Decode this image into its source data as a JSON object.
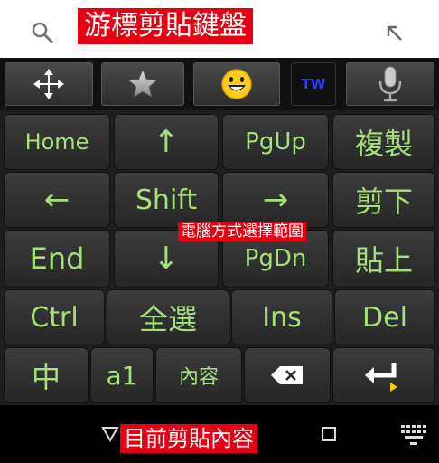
{
  "header": {
    "title_label": "游標剪貼鍵盤",
    "search_icon": "search-icon",
    "back_icon": "arrow-up-left-icon"
  },
  "toolbar": {
    "buttons": [
      {
        "name": "move-cursor",
        "icon": "move-arrows-icon"
      },
      {
        "name": "favorite",
        "icon": "star-icon"
      },
      {
        "name": "emoji",
        "icon": "emoji-icon"
      },
      {
        "name": "language",
        "label": "TW"
      },
      {
        "name": "voice",
        "icon": "microphone-icon"
      }
    ]
  },
  "keys": {
    "home": "Home",
    "up": "↑",
    "pgup": "PgUp",
    "copy": "複製",
    "left": "←",
    "shift": "Shift",
    "right": "→",
    "cut": "剪下",
    "end": "End",
    "down": "↓",
    "pgdn": "PgDn",
    "paste": "貼上",
    "ctrl": "Ctrl",
    "select_all": "全選",
    "ins": "Ins",
    "del": "Del",
    "chinese": "中",
    "a1": "a1",
    "content": "內容"
  },
  "annotations": {
    "mid": "電腦方式選擇範圍",
    "bottom": "目前剪貼內容"
  },
  "colors": {
    "key_text": "#a6e07a",
    "label_bg": "#e60012"
  }
}
